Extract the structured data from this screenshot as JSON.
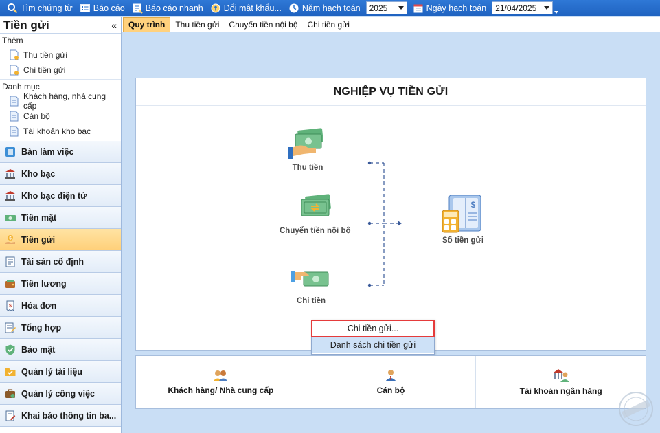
{
  "toolbar": {
    "search": "Tìm chứng từ",
    "report": "Báo cáo",
    "quick_report": "Báo cáo nhanh",
    "change_password": "Đổi mật khẩu...",
    "fiscal_year_label": "Năm hạch toán",
    "fiscal_year_value": "2025",
    "posting_date_label": "Ngày hạch toán",
    "posting_date_value": "21/04/2025"
  },
  "left_panel": {
    "title": "Tiền gửi",
    "collapse": "«",
    "groups": [
      {
        "label": "Thêm",
        "items": [
          "Thu tiền gửi",
          "Chi tiền gửi"
        ]
      },
      {
        "label": "Danh mục",
        "items": [
          "Khách hàng, nhà cung cấp",
          "Cán bộ",
          "Tài khoản kho bạc"
        ]
      }
    ],
    "modules": [
      "Bàn làm việc",
      "Kho bạc",
      "Kho bạc điện tử",
      "Tiền mặt",
      "Tiền gửi",
      "Tài sản cố định",
      "Tiền lương",
      "Hóa đơn",
      "Tổng hợp",
      "Bảo mật",
      "Quản lý tài liệu",
      "Quản lý công việc",
      "Khai báo thông tin ba..."
    ],
    "active_module": "Tiền gửi"
  },
  "tabs": [
    "Quy trình",
    "Thu tiền gửi",
    "Chuyển tiền nội bộ",
    "Chi tiền gửi"
  ],
  "process": {
    "title": "NGHIỆP VỤ TIỀN GỬI",
    "nodes": {
      "receive": "Thu tiền",
      "transfer": "Chuyển tiền nội bộ",
      "pay": "Chi tiền",
      "ledger": "Sổ tiền gửi"
    }
  },
  "context_menu": {
    "items": [
      "Chi tiền gửi...",
      "Danh sách chi tiền gửi"
    ]
  },
  "shortcuts": [
    "Khách hàng/ Nhà cung cấp",
    "Cán bộ",
    "Tài khoản ngân hàng"
  ],
  "colors": {
    "toolbar_blue": "#2470cf",
    "active_orange": "#ffd07a",
    "money_green": "#5fb27a",
    "highlight_red": "#e53b3b"
  }
}
